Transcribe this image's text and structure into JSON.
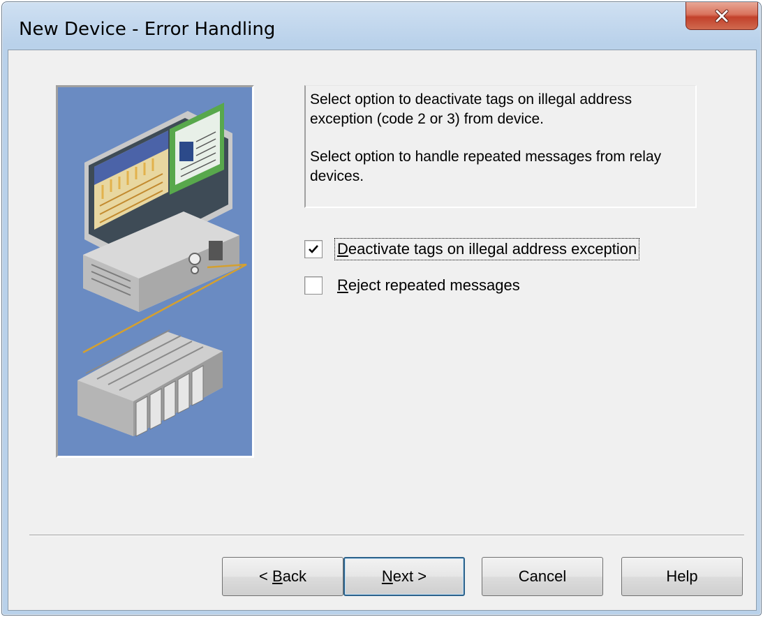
{
  "window": {
    "title": "New Device - Error Handling"
  },
  "description": {
    "paragraph1": "Select option to deactivate tags on illegal address exception (code 2 or 3) from device.",
    "paragraph2": "Select option to handle repeated messages from relay devices."
  },
  "options": [
    {
      "mnemonic": "D",
      "label_rest": "eactivate tags on illegal address exception",
      "checked": true
    },
    {
      "mnemonic": "R",
      "label_rest": "eject repeated messages",
      "checked": false
    }
  ],
  "buttons": {
    "back": {
      "prefix": "< ",
      "mnemonic": "B",
      "rest": "ack"
    },
    "next": {
      "mnemonic": "N",
      "rest": "ext >"
    },
    "cancel": "Cancel",
    "help": "Help"
  },
  "colors": {
    "panel_bg": "#6a8bc2",
    "dialog_bg": "#f0f0f0",
    "close_button": "#c2412b"
  },
  "icons": {
    "close": "close-x-icon",
    "check": "checkmark-icon",
    "illustration": "computer-plc-illustration"
  }
}
